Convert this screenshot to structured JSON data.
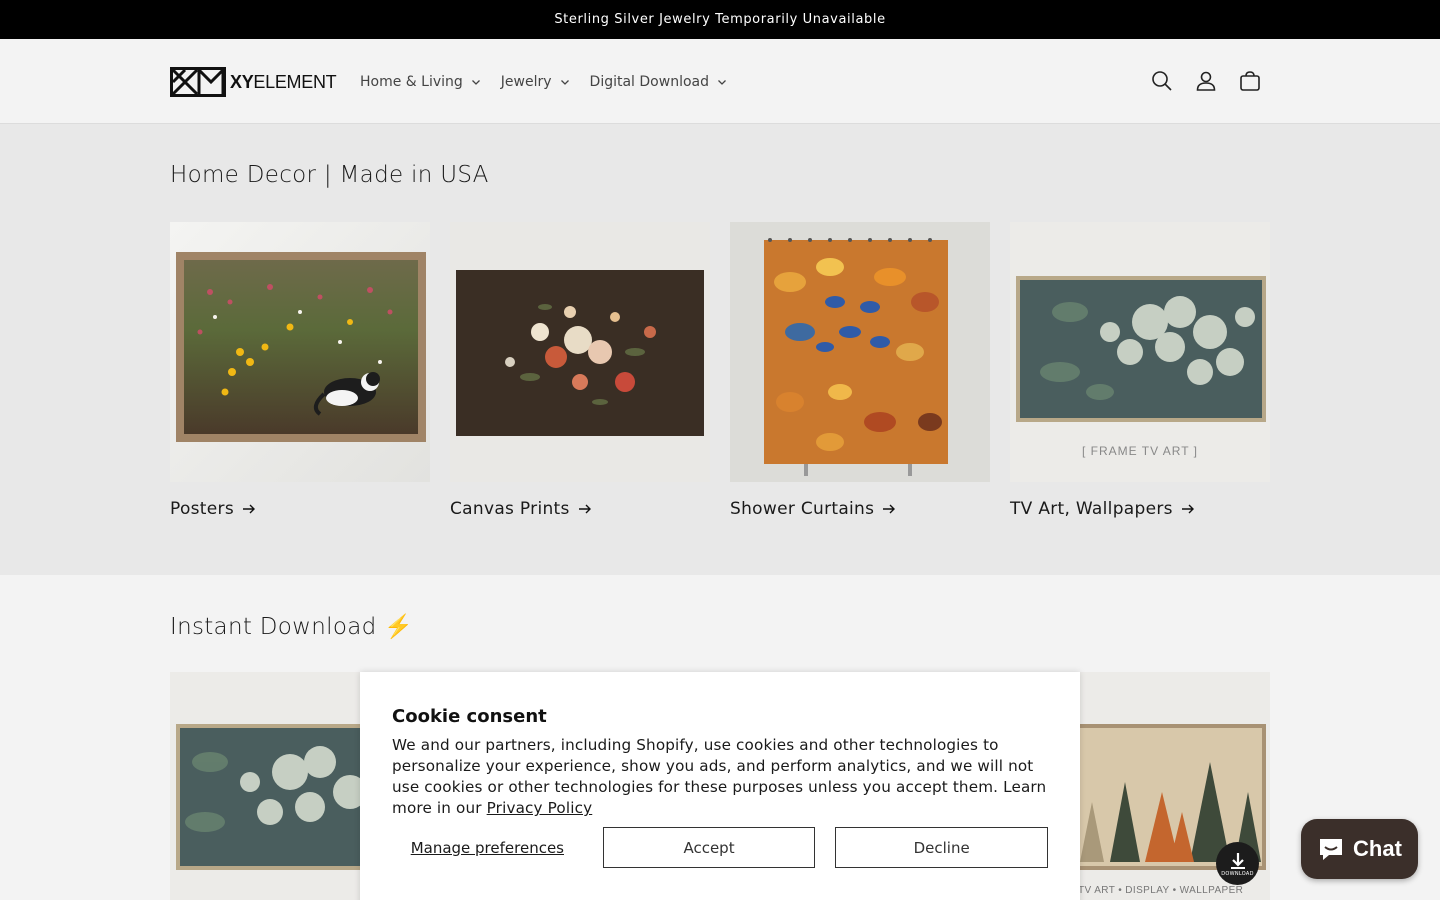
{
  "announcement": {
    "text": "Sterling Silver Jewelry Temporarily Unavailable"
  },
  "header": {
    "logo_text_bold": "XY",
    "logo_text": "ELEMENT",
    "nav": [
      {
        "label": "Home & Living"
      },
      {
        "label": "Jewelry"
      },
      {
        "label": "Digital Download"
      }
    ],
    "icons": [
      "search-icon",
      "account-icon",
      "cart-icon"
    ]
  },
  "home_decor": {
    "title": "Home Decor | Made in USA",
    "cards": [
      {
        "label": "Posters"
      },
      {
        "label": "Canvas Prints"
      },
      {
        "label": "Shower Curtains"
      },
      {
        "label": "TV Art, Wallpapers",
        "image_caption": "[ FRAME TV ART ]"
      }
    ]
  },
  "instant_download": {
    "title": "Instant Download ⚡",
    "right_image_caption": "TV ART • DISPLAY • WALLPAPER"
  },
  "cookie": {
    "title": "Cookie consent",
    "text": "We and our partners, including Shopify, use cookies and other technologies to personalize your experience, show you ads, and perform analytics, and we will not use cookies or other technologies for these purposes unless you accept them. Learn more in our",
    "link": "Privacy Policy",
    "manage": "Manage preferences",
    "accept": "Accept",
    "decline": "Decline"
  },
  "chat": {
    "label": "Chat"
  },
  "download_badge": {
    "label": "DOWNLOAD"
  }
}
